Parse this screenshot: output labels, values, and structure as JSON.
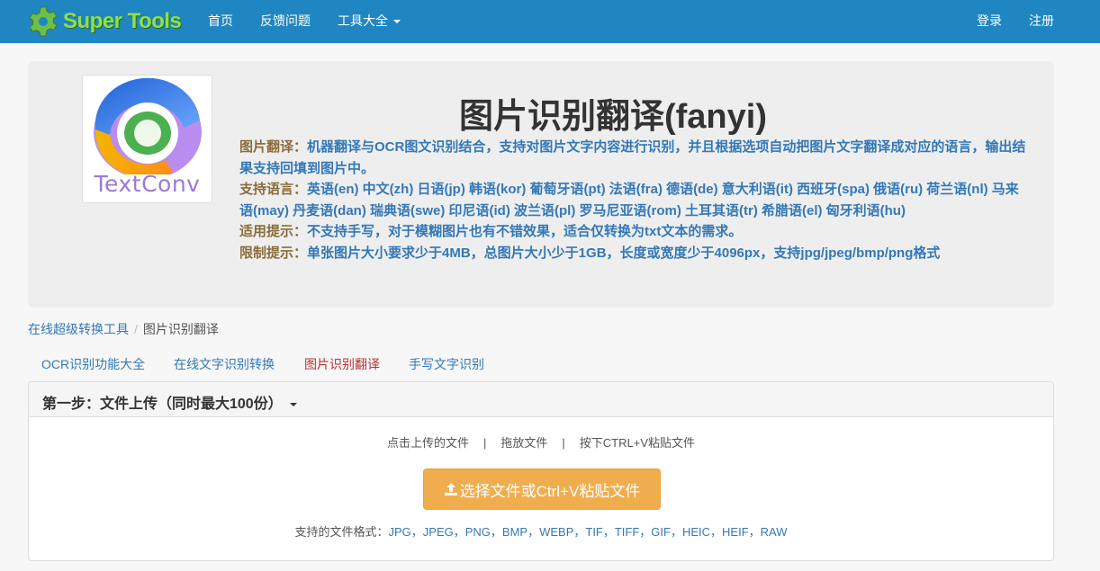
{
  "navbar": {
    "brand": "Super Tools",
    "links": [
      "首页",
      "反馈问题",
      "工具大全"
    ],
    "login": "登录",
    "register": "注册"
  },
  "jumbotron": {
    "logo_text": "TextConv",
    "title": "图片识别翻译(fanyi)",
    "lines": [
      {
        "label": "图片翻译：",
        "text": "机器翻译与OCR图文识别结合，支持对图片文字内容进行识别，并且根据选项自动把图片文字翻译成对应的语言，输出结果支持回填到图片中。"
      },
      {
        "label": "支持语言：",
        "text": "英语(en) 中文(zh) 日语(jp) 韩语(kor) 葡萄牙语(pt) 法语(fra) 德语(de) 意大利语(it) 西班牙(spa) 俄语(ru) 荷兰语(nl) 马来语(may) 丹麦语(dan) 瑞典语(swe) 印尼语(id) 波兰语(pl) 罗马尼亚语(rom) 土耳其语(tr) 希腊语(el) 匈牙利语(hu)"
      },
      {
        "label": "适用提示：",
        "text": "不支持手写，对于模糊图片也有不错效果，适合仅转换为txt文本的需求。"
      },
      {
        "label": "限制提示：",
        "text": "单张图片大小要求少于4MB，总图片大小少于1GB，长度或宽度少于4096px，支持jpg/jpeg/bmp/png格式"
      }
    ]
  },
  "breadcrumb": {
    "home": "在线超级转换工具",
    "current": "图片识别翻译"
  },
  "tabs": [
    "OCR识别功能大全",
    "在线文字识别转换",
    "图片识别翻译",
    "手写文字识别"
  ],
  "panel": {
    "title": "第一步：文件上传（同时最大100份）",
    "hint_click": "点击上传的文件",
    "hint_sep": "|",
    "hint_drag": "拖放文件",
    "hint_paste": "按下CTRL+V粘贴文件",
    "upload_button": "选择文件或Ctrl+V粘贴文件",
    "formats_label": "支持的文件格式：",
    "formats_value": "JPG，JPEG，PNG，BMP，WEBP，TIF，TIFF，GIF，HEIC，HEIF，RAW"
  },
  "colors": {
    "navbar": "#1f86c2",
    "link": "#3478b7",
    "label": "#8a6d3b",
    "active_tab": "#b8312f",
    "upload_button": "#f0ad4e"
  }
}
